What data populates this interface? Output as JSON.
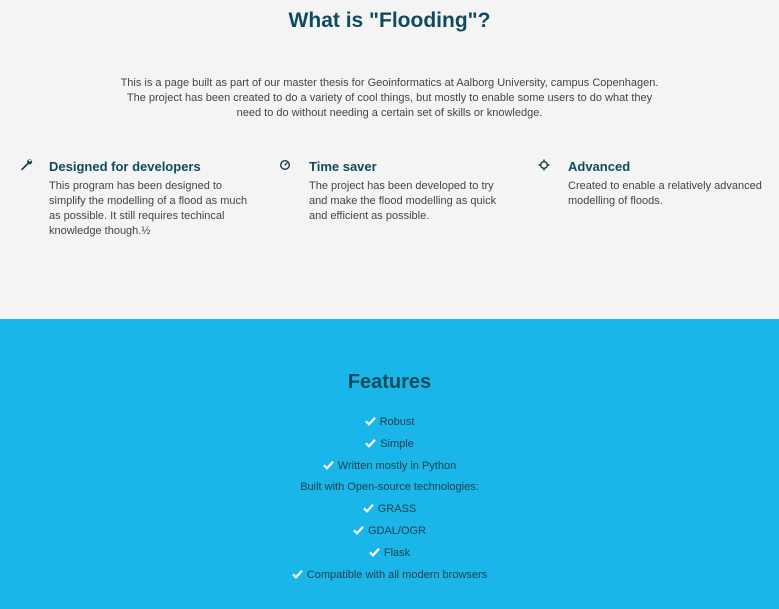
{
  "hero": {
    "title": "What is \"Flooding\"?",
    "intro": "This is a page built as part of our master thesis for Geoinformatics at Aalborg University, campus Copenhagen. The project has been created to do a variety of cool things, but mostly to enable some users to do what they need to do without needing a certain set of skills or knowledge."
  },
  "columns": [
    {
      "icon": "wrench-icon",
      "title": "Designed for developers",
      "text": "This program has been designed to simplify the modelling of a flood as much as possible. It still requires techincal knowledge though.½"
    },
    {
      "icon": "clock-icon",
      "title": "Time saver",
      "text": "The project has been developed to try and make the flood modelling as quick and efficient as possible."
    },
    {
      "icon": "crosshair-icon",
      "title": "Advanced",
      "text": "Created to enable a relatively advanced modelling of floods."
    }
  ],
  "features": {
    "title": "Features",
    "items": [
      {
        "label": "Robust",
        "check": true
      },
      {
        "label": "Simple",
        "check": true
      },
      {
        "label": "Written mostly in Python",
        "check": true
      },
      {
        "label": "Built with Open-source technologies:",
        "check": false
      },
      {
        "label": "GRASS",
        "check": true
      },
      {
        "label": "GDAL/OGR",
        "check": true
      },
      {
        "label": "Flask",
        "check": true
      },
      {
        "label": "Compatible with all modern browsers",
        "check": true
      }
    ]
  },
  "colors": {
    "heading": "#0f4b5c",
    "features_bg": "#1ab6e9",
    "top_bg": "#f4f4f4"
  }
}
